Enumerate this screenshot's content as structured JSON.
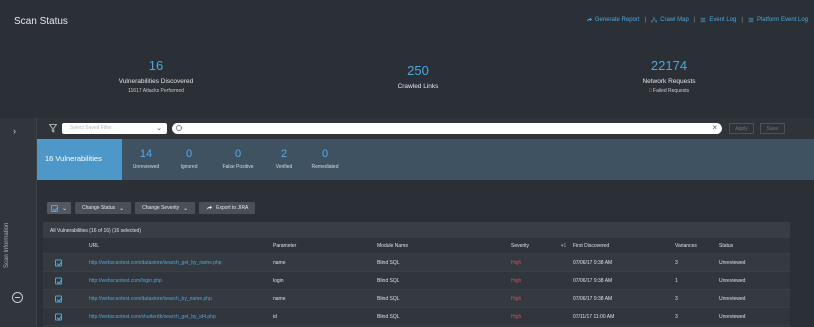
{
  "header": {
    "title": "Scan Status",
    "links": [
      "Generate Report",
      "Crawl Map",
      "Event Log",
      "Platform Event Log"
    ]
  },
  "stats": {
    "vulns": {
      "num": "16",
      "label": "Vulnerabilities Discovered",
      "sub": "11617 Attacks Performed"
    },
    "crawled": {
      "num": "250",
      "label": "Crawled Links"
    },
    "requests": {
      "num": "22174",
      "label": "Network Requests",
      "sub": "Failed Requests",
      "sub_prefix": "0"
    }
  },
  "rail": {
    "label": "Scan Information"
  },
  "filter": {
    "saved_placeholder": "Select Saved Filter",
    "apply": "Apply",
    "save": "Save"
  },
  "summary": {
    "total": "16 Vulnerabilities",
    "counts": [
      {
        "n": "14",
        "label": "Unreviewed"
      },
      {
        "n": "0",
        "label": "Ignored"
      },
      {
        "n": "0",
        "label": "False Positive"
      },
      {
        "n": "2",
        "label": "Verified"
      },
      {
        "n": "0",
        "label": "Remediated"
      }
    ]
  },
  "toolbar": {
    "change_status": "Change Status",
    "change_severity": "Change Severity",
    "export": "Export to JIRA"
  },
  "table": {
    "caption": "All Vulnerabilities (16 of 16) (16 selected)",
    "columns": [
      "URL",
      "Parameter",
      "Module Name",
      "Severity",
      "First Discovered",
      "Variances",
      "Status"
    ],
    "rows": [
      {
        "url": "http://webscantest.com/datastore/search_get_by_name.php",
        "param": "name",
        "module": "Blind SQL",
        "severity": "High",
        "first": "07/06/17 9:38 AM",
        "variances": "3",
        "status": "Unreviewed"
      },
      {
        "url": "http://webscantest.com/login.php",
        "param": "login",
        "module": "Blind SQL",
        "severity": "High",
        "first": "07/06/17 9:38 AM",
        "variances": "1",
        "status": "Unreviewed"
      },
      {
        "url": "http://webscantest.com/datastore/search_by_name.php",
        "param": "name",
        "module": "Blind SQL",
        "severity": "High",
        "first": "07/06/17 9:38 AM",
        "variances": "3",
        "status": "Unreviewed"
      },
      {
        "url": "http://webscantest.com/shutterdb/search_get_by_id4.php",
        "param": "id",
        "module": "Blind SQL",
        "severity": "High",
        "first": "07/11/17 11:00 AM",
        "variances": "3",
        "status": "Unreviewed"
      }
    ]
  },
  "colors": {
    "accent": "#4aa8e0",
    "severity_high": "#e04848",
    "summary_tile": "#4d98c9"
  }
}
